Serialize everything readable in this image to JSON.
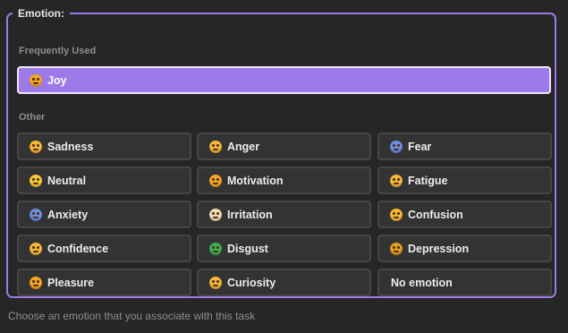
{
  "legend": "Emotion:",
  "frequent": {
    "label": "Frequently Used",
    "items": [
      {
        "label": "Joy",
        "icon": "joy-emoji-icon",
        "color": "#f5a623",
        "selected": true
      }
    ]
  },
  "other": {
    "label": "Other",
    "items": [
      {
        "label": "Sadness",
        "icon": "sadness-emoji-icon",
        "color": "#f5b836"
      },
      {
        "label": "Anger",
        "icon": "anger-emoji-icon",
        "color": "#f5b836"
      },
      {
        "label": "Fear",
        "icon": "fear-emoji-icon",
        "color": "#6a8fe0"
      },
      {
        "label": "Neutral",
        "icon": "neutral-emoji-icon",
        "color": "#f5c836"
      },
      {
        "label": "Motivation",
        "icon": "flexed-biceps-icon",
        "color": "#f5a623"
      },
      {
        "label": "Fatigue",
        "icon": "fatigue-emoji-icon",
        "color": "#f5b836"
      },
      {
        "label": "Anxiety",
        "icon": "anxiety-emoji-icon",
        "color": "#6a8fe0"
      },
      {
        "label": "Irritation",
        "icon": "irritation-emoji-icon",
        "color": "#f0d9b5"
      },
      {
        "label": "Confusion",
        "icon": "confusion-emoji-icon",
        "color": "#f5b836"
      },
      {
        "label": "Confidence",
        "icon": "confidence-emoji-icon",
        "color": "#f5b836"
      },
      {
        "label": "Disgust",
        "icon": "disgust-emoji-icon",
        "color": "#3cb055"
      },
      {
        "label": "Depression",
        "icon": "depression-emoji-icon",
        "color": "#e0a020"
      },
      {
        "label": "Pleasure",
        "icon": "pleasure-emoji-icon",
        "color": "#f5a623"
      },
      {
        "label": "Curiosity",
        "icon": "curiosity-emoji-icon",
        "color": "#f5b836"
      },
      {
        "label": "No emotion",
        "icon": "",
        "color": ""
      }
    ]
  },
  "hint": "Choose an emotion that you associate with this task",
  "colors": {
    "accent": "#9d7ae8",
    "border_accent": "#9c7be3",
    "background": "#262626",
    "button_bg": "#333333"
  }
}
